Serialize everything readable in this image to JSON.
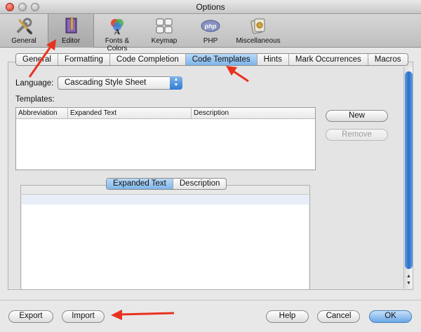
{
  "window": {
    "title": "Options"
  },
  "toolbar": {
    "items": [
      {
        "label": "General",
        "icon": "wrench-screwdriver-icon"
      },
      {
        "label": "Editor",
        "icon": "notebook-pen-icon"
      },
      {
        "label": "Fonts & Colors",
        "icon": "fonts-colors-icon"
      },
      {
        "label": "Keymap",
        "icon": "keyboard-icon"
      },
      {
        "label": "PHP",
        "icon": "php-logo-icon"
      },
      {
        "label": "Miscellaneous",
        "icon": "misc-cards-icon"
      }
    ],
    "selected": "Editor"
  },
  "tabs": {
    "items": [
      "General",
      "Formatting",
      "Code Completion",
      "Code Templates",
      "Hints",
      "Mark Occurrences",
      "Macros"
    ],
    "active": "Code Templates"
  },
  "language": {
    "label": "Language:",
    "value": "Cascading Style Sheet"
  },
  "templates": {
    "label": "Templates:",
    "columns": [
      "Abbreviation",
      "Expanded Text",
      "Description"
    ],
    "rows": []
  },
  "side_buttons": {
    "new_label": "New",
    "remove_label": "Remove"
  },
  "lower_tabs": {
    "items": [
      "Expanded Text",
      "Description"
    ],
    "active": "Expanded Text"
  },
  "bottom_buttons": {
    "export_label": "Export",
    "import_label": "Import",
    "help_label": "Help",
    "cancel_label": "Cancel",
    "ok_label": "OK"
  },
  "colors": {
    "selection_blue": "#7eb5ea",
    "annotation_red": "#e8321f"
  }
}
